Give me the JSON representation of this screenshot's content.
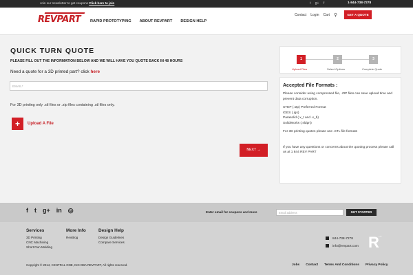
{
  "topbar": {
    "newsletter_text": "Join our newsletter to get coupons",
    "newsletter_link": "Click here to join",
    "social_icons": [
      "twitter-icon",
      "google-plus-icon",
      "facebook-icon"
    ],
    "phone": "1-844-738-7278"
  },
  "header": {
    "contact": "Contact",
    "login": "Login",
    "cart": "Cart",
    "quote_button": "GET A QUOTE",
    "logo_text": "REVPART",
    "nav": [
      "RAPID PROTOTYPING",
      "ABOUT REVPART",
      "DESIGN HELP"
    ]
  },
  "main": {
    "title": "QUICK TURN QUOTE",
    "subhead": "PLEASE FILL OUT THE INFORMATION BELOW AND WE WILL HAVE YOU QUOTE BACK IN 48 HOURS",
    "need_text": "Need a quote for a 3D printed part? click",
    "need_link": "here",
    "email_placeholder": "EMAIL*",
    "info": "For 3D printing only .stl files or .zip files containing .stl files only.",
    "upload_label": "Upload A File",
    "upload_icon": "+",
    "next_button": "NEXT →"
  },
  "steps": [
    {
      "number": "1",
      "label": "Upload Files",
      "active": true
    },
    {
      "number": "2",
      "label": "Select Options",
      "active": false
    },
    {
      "number": "3",
      "label": "Complete Quote",
      "active": false
    }
  ],
  "formats": {
    "title": "Accepted File Formats :",
    "intro": "Please consider using compressed file, .ZIP files can save upload time and prevent data corruption.",
    "list": [
      "STEP (.stp) Preferred Format",
      "IGES (.igs)",
      "Parasolid (.x_t and .x_b)",
      "SolidWorks (.sldprt)"
    ],
    "note": "For 3D printing quotes please use .STL file formats",
    "contact": "If you have any questions or concerns about the quoting process please call us at 1 844 REV PART"
  },
  "footer": {
    "social": [
      "f",
      "t",
      "g+",
      "in",
      "◎"
    ],
    "cta": "Enter email for coupons and more",
    "email_placeholder": "Email address",
    "button": "GET STARTED",
    "services": {
      "title": "Services",
      "items": [
        "3D Printing",
        "CNC Machining",
        "Short Run Molding"
      ]
    },
    "more_info": {
      "title": "More Info",
      "items": [
        "RevBlog"
      ]
    },
    "design_help": {
      "title": "Design Help",
      "items": [
        "Design Guidelines",
        "Compare Services"
      ]
    },
    "phone": "844-738-7278",
    "email": "info@revpart.com",
    "copyright": "Copyright © 2014, CENTRAL ONE, INC DBA REVPART, All rights reserved.",
    "links": [
      "Jobs",
      "Contact",
      "Terms And Conditions",
      "Privacy Policy"
    ]
  }
}
